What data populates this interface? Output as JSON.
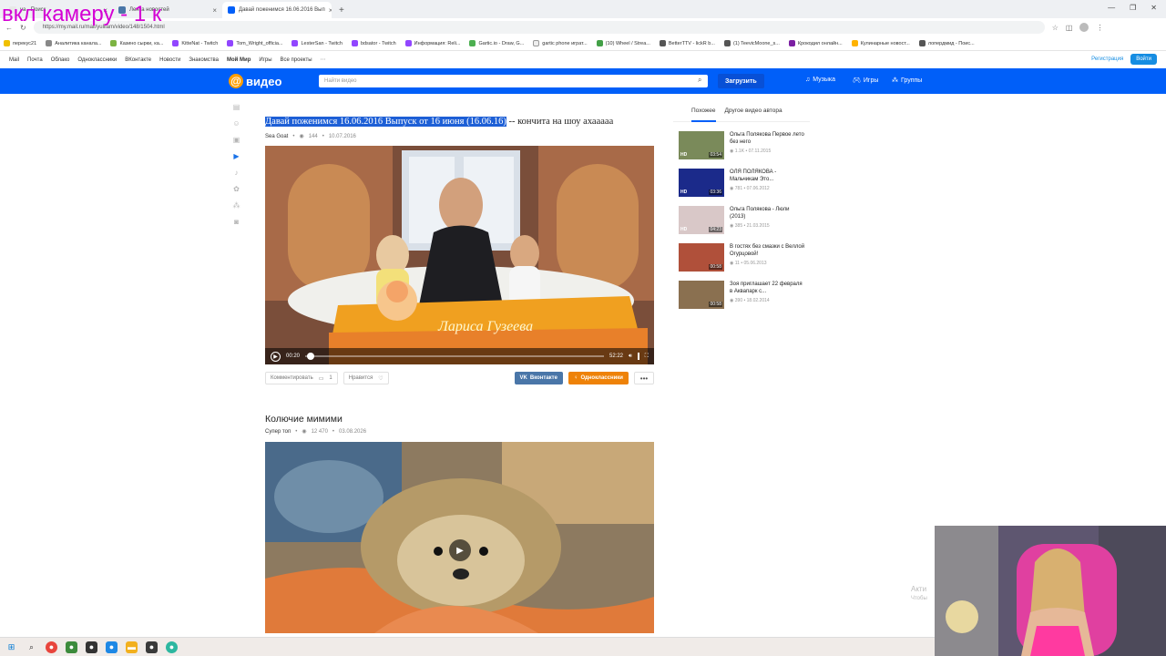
{
  "overlay": {
    "text": "вкл камеру - 1 к"
  },
  "browser": {
    "tabs": [
      {
        "label": "ya - Поиск",
        "active": false
      },
      {
        "label": "Лента новостей",
        "active": false
      },
      {
        "label": "Давай поженимся 16.06.2016 Вып",
        "active": true
      }
    ],
    "new_tab": "+",
    "window_controls": [
      "—",
      "❐",
      "✕"
    ],
    "url": "https://my.mail.ru/mail/yuliiam/video/148/1504.html",
    "bookmarks": [
      "перекус21",
      "Аналитика канала...",
      "Казино сырки, ка...",
      "KitteNat - Twitch",
      "Tom_Wright_officia...",
      "LesterSan - Twitch",
      "bdsator - Twitch",
      "Информация: Reli...",
      "Gartic.io - Draw, G...",
      "gartic phone играт...",
      "(10) Wheel / Strea...",
      "BetterTTV - lickR b...",
      "(1) TeevicMoone_s...",
      "Крокодил онлайн...",
      "Кулинарные новост...",
      "лопердмид - Поис..."
    ]
  },
  "portal": {
    "links": [
      "Mail",
      "Почта",
      "Облако",
      "Одноклассники",
      "ВКонтакте",
      "Новости",
      "Знакомства",
      "Мой Мир",
      "Игры",
      "Все проекты"
    ],
    "register": "Регистрация",
    "login": "Войти"
  },
  "header": {
    "logo_text": "видео",
    "search_placeholder": "Найти видео",
    "upload_label": "Загрузить",
    "nav": [
      "Музыка",
      "Игры",
      "Группы"
    ]
  },
  "video1": {
    "title_highlight": "Давай поженимся 16.06.2016 Выпуск от 16 июня (16.06.16)",
    "title_rest": " -- кончита на шоу ахааааа",
    "author": "Sea Goat",
    "views": "144",
    "date": "10.07.2016",
    "overlay_name": "Лариса Гузеева",
    "time_current": "00:20",
    "time_total": "52:22",
    "progress_fraction": 0.006,
    "comment_label": "Комментировать",
    "comment_count": "1",
    "like_label": "Нравится",
    "share_vk": "Вконтакте",
    "share_ok": "Одноклассники",
    "more": "•••"
  },
  "video2": {
    "title": "Колючие мимими",
    "author": "Супер топ",
    "views": "12 470",
    "date": "03.08.2026"
  },
  "side": {
    "tabs": [
      "Похожее",
      "Другое видео автора"
    ],
    "items": [
      {
        "title": "Ольга Полякова Первое лето без него",
        "views": "1.1K",
        "date": "07.11.2015",
        "duration": "03:54",
        "hd": "HD",
        "color": "#7a8a5a"
      },
      {
        "title": "ОЛЯ ПОЛЯКОВА - Мальчикам Это...",
        "views": "781",
        "date": "07.06.2012",
        "duration": "03:36",
        "hd": "HD",
        "color": "#1b2a8a"
      },
      {
        "title": "Ольга Полякова - Люли (2013)",
        "views": "385",
        "date": "21.03.2015",
        "duration": "04:23",
        "hd": "HD",
        "color": "#d9c8c8"
      },
      {
        "title": "В гостях без смазки с Веллой Огурцовой!",
        "views": "11",
        "date": "05.06.2013",
        "duration": "00:58",
        "hd": "",
        "color": "#b0503a"
      },
      {
        "title": "Зоя приглашает 22 февраля в Аквапарк с...",
        "views": "390",
        "date": "18.02.2014",
        "duration": "00:58",
        "hd": "",
        "color": "#8a7050"
      }
    ]
  },
  "watermark": {
    "line1": "Акти",
    "line2": "Чтобы"
  }
}
